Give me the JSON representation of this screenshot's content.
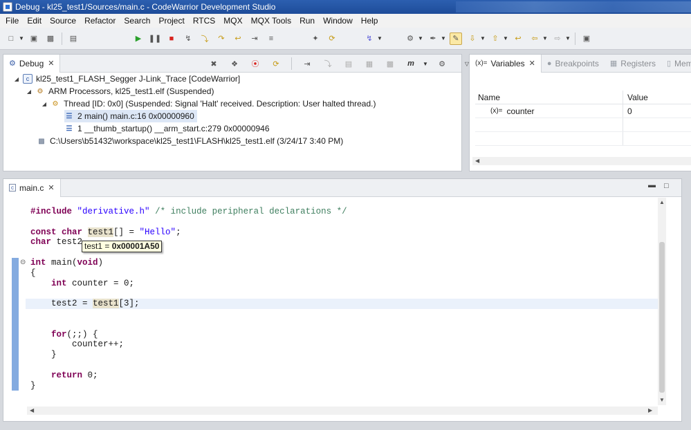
{
  "window": {
    "title": "Debug - kl25_test1/Sources/main.c - CodeWarrior Development Studio"
  },
  "menu": [
    "File",
    "Edit",
    "Source",
    "Refactor",
    "Search",
    "Project",
    "RTCS",
    "MQX",
    "MQX Tools",
    "Run",
    "Window",
    "Help"
  ],
  "toolbar_icons": [
    "new-icon",
    "save-icon",
    "save-all-icon",
    "print-icon",
    "resume-icon",
    "suspend-icon",
    "terminate-icon",
    "disconnect-icon",
    "step-into-icon",
    "step-over-icon",
    "step-return-icon",
    "instruction-step-icon",
    "connect-icon",
    "reset-icon",
    "flash-icon",
    "debug-icon",
    "external-tools-icon",
    "edit-icon",
    "annotation-icon",
    "back-icon",
    "forward-icon",
    "pin-icon"
  ],
  "debug_view": {
    "tab_label": "Debug",
    "tree": [
      {
        "label": "kl25_test1_FLASH_Segger J-Link_Trace [CodeWarrior]",
        "icon": "debug-launch-icon",
        "level": 0,
        "expanded": true
      },
      {
        "label": "ARM Processors, kl25_test1.elf (Suspended)",
        "icon": "processor-icon",
        "level": 1,
        "expanded": true
      },
      {
        "label": "Thread [ID: 0x0] (Suspended: Signal 'Halt' received. Description: User halted thread.)",
        "icon": "thread-icon",
        "level": 2,
        "expanded": true
      },
      {
        "label": "2 main() main.c:16 0x00000960",
        "icon": "stack-frame-icon",
        "level": 3,
        "selected": true
      },
      {
        "label": "1 __thumb_startup() __arm_start.c:279 0x00000946",
        "icon": "stack-frame-icon",
        "level": 3
      },
      {
        "label": "C:\\Users\\b51432\\workspace\\kl25_test1\\FLASH\\kl25_test1.elf (3/24/17 3:40 PM)",
        "icon": "executable-icon",
        "level": 1
      }
    ]
  },
  "variables_view": {
    "tabs": [
      "Variables",
      "Breakpoints",
      "Registers",
      "Memo"
    ],
    "columns": [
      "Name",
      "Value"
    ],
    "rows": [
      {
        "name": "counter",
        "value": "0"
      }
    ]
  },
  "editor": {
    "tab_label": "main.c",
    "lines": [
      {
        "parts": [
          [
            "pre",
            "#include "
          ],
          [
            "str",
            "\"derivative.h\""
          ],
          [
            "",
            " "
          ],
          [
            "cmt",
            "/* include peripheral declarations */"
          ]
        ]
      },
      {
        "parts": []
      },
      {
        "parts": [
          [
            "kw",
            "const char "
          ],
          [
            "hl",
            "test1"
          ],
          [
            "",
            "[] = "
          ],
          [
            "str",
            "\"Hello\""
          ],
          [
            "",
            ";"
          ]
        ]
      },
      {
        "parts": [
          [
            "kw",
            "char "
          ],
          [
            "",
            "test2"
          ]
        ]
      },
      {
        "parts": []
      },
      {
        "parts": [
          [
            "kw",
            "int "
          ],
          [
            "",
            "main("
          ],
          [
            "kw",
            "void"
          ],
          [
            "",
            ")"
          ]
        ]
      },
      {
        "parts": [
          [
            "",
            "{"
          ]
        ]
      },
      {
        "parts": [
          [
            "",
            "    "
          ],
          [
            "kw",
            "int "
          ],
          [
            "",
            "counter = 0;"
          ]
        ]
      },
      {
        "parts": []
      },
      {
        "parts": [
          [
            "",
            "    test2 = "
          ],
          [
            "hl",
            "test1"
          ],
          [
            "",
            "[3];"
          ]
        ]
      },
      {
        "parts": []
      },
      {
        "parts": []
      },
      {
        "parts": [
          [
            "",
            "    "
          ],
          [
            "kw",
            "for"
          ],
          [
            "",
            "(;;) {"
          ]
        ]
      },
      {
        "parts": [
          [
            "",
            "        counter++;"
          ]
        ]
      },
      {
        "parts": [
          [
            "",
            "    }"
          ]
        ]
      },
      {
        "parts": []
      },
      {
        "parts": [
          [
            "",
            "    "
          ],
          [
            "kw",
            "return "
          ],
          [
            "",
            "0;"
          ]
        ]
      },
      {
        "parts": [
          [
            "",
            "}"
          ]
        ]
      }
    ],
    "tooltip_prefix": "test1 = ",
    "tooltip_value": "0x00001A50"
  }
}
